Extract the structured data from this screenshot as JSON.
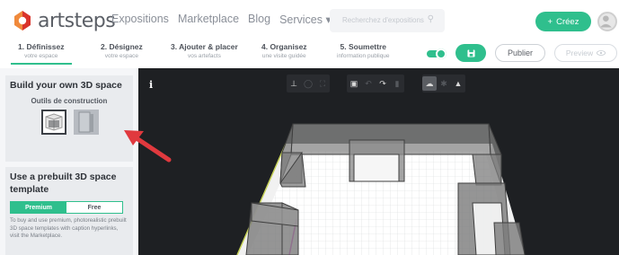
{
  "header": {
    "brand": "artsteps",
    "nav": [
      "Expositions",
      "Marketplace",
      "Blog",
      "Services ▾"
    ],
    "search": {
      "placeholder": "Recherchez d'expositions"
    },
    "create_label": "Créez"
  },
  "steps": [
    {
      "title": "1. Définissez",
      "subtitle": "votre espace",
      "active": true
    },
    {
      "title": "2. Désignez",
      "subtitle": "votre espace",
      "active": false
    },
    {
      "title": "3. Ajouter & placer",
      "subtitle": "vos artefacts",
      "active": false
    },
    {
      "title": "4. Organisez",
      "subtitle": "une visite guidée",
      "active": false
    },
    {
      "title": "5. Soumettre",
      "subtitle": "information publique",
      "active": false
    }
  ],
  "actions": {
    "publish_label": "Publier",
    "preview_label": "Preview"
  },
  "sidebar": {
    "build_title": "Build your own 3D space",
    "tools_label": "Outils de construction",
    "prebuilt_title": "Use a prebuilt 3D space template",
    "tabs": [
      "Premium",
      "Free"
    ],
    "description": "To buy and use premium, photorealistic prebuilt 3D space templates with caption hyperlinks, visit the Marketplace."
  },
  "viewport": {
    "info_label": "i"
  },
  "colors": {
    "accent": "#2fbf8d",
    "arrow": "#e0393e",
    "logo_orange": "#f08a3c",
    "logo_red": "#d9342b"
  }
}
